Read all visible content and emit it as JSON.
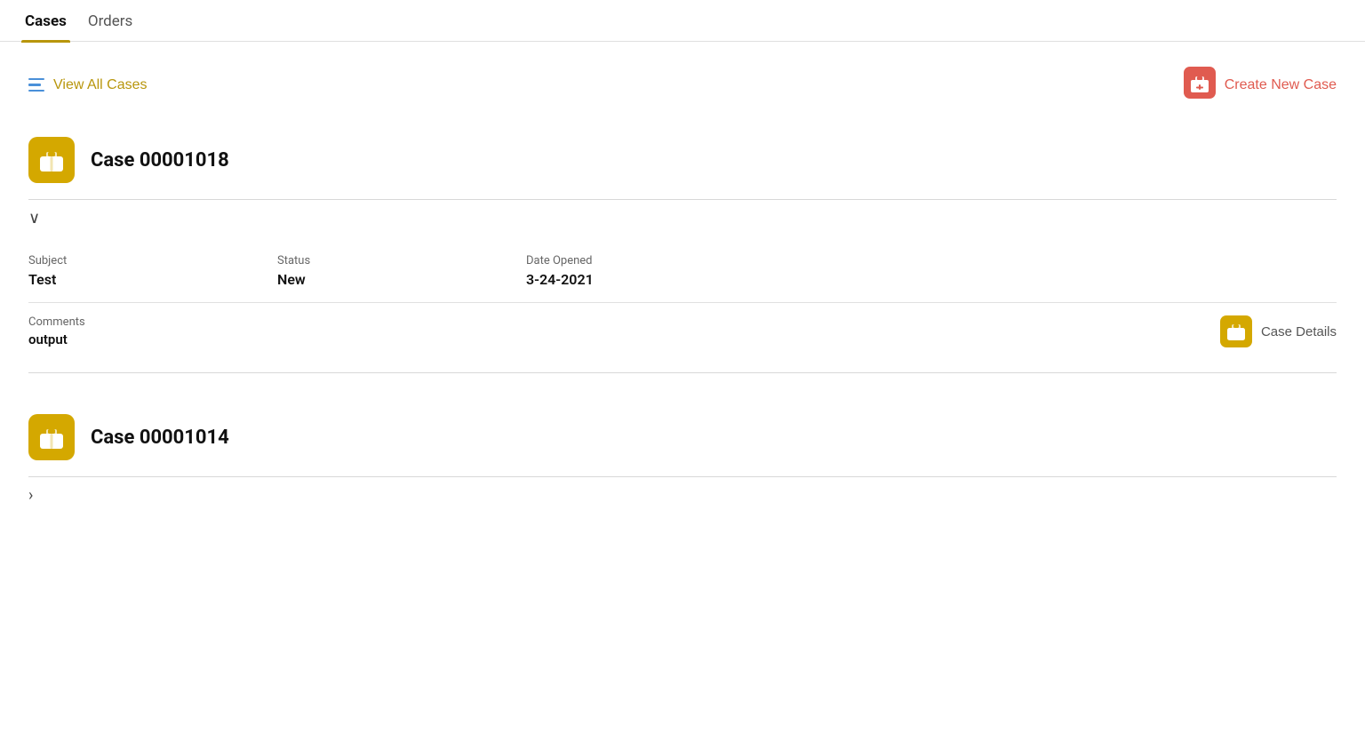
{
  "tabs": [
    {
      "label": "Cases",
      "active": true
    },
    {
      "label": "Orders",
      "active": false
    }
  ],
  "toolbar": {
    "view_all_label": "View All Cases",
    "create_label": "Create New Case"
  },
  "cases": [
    {
      "id": "case-1",
      "case_number": "Case 00001018",
      "expanded": true,
      "subject_label": "Subject",
      "subject_value": "Test",
      "status_label": "Status",
      "status_value": "New",
      "date_label": "Date Opened",
      "date_value": "3-24-2021",
      "comments_label": "Comments",
      "comments_value": "output",
      "case_details_label": "Case Details",
      "toggle_icon_expanded": "∨",
      "toggle_icon_collapsed": "›"
    },
    {
      "id": "case-2",
      "case_number": "Case 00001014",
      "expanded": false,
      "toggle_icon_collapsed": "›"
    }
  ],
  "icons": {
    "list_icon_color": "#4a90d9",
    "create_icon_color": "#e05b50",
    "case_icon_color": "#d4a800"
  }
}
